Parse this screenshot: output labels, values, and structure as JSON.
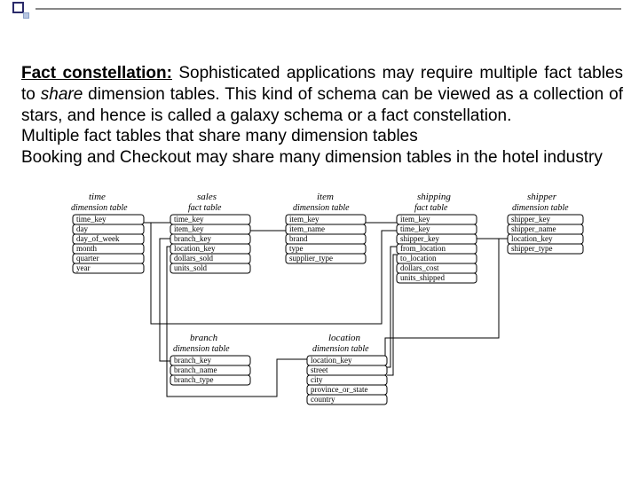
{
  "heading": {
    "title": "Fact constellation:",
    "desc1a": " Sophisticated applications may require multiple fact tables to ",
    "desc1_share": "share",
    "desc1b": " dimension tables. This kind of schema can be viewed as a collection of stars, and hence is called a galaxy schema or a fact constellation.",
    "line2": "Multiple fact tables that share many dimension tables",
    "line3": "Booking and Checkout may share many dimension tables in the hotel industry"
  },
  "tables": {
    "time": {
      "name": "time",
      "sub": "dimension table",
      "cols": [
        "time_key",
        "day",
        "day_of_week",
        "month",
        "quarter",
        "year"
      ]
    },
    "sales": {
      "name": "sales",
      "sub": "fact table",
      "cols": [
        "time_key",
        "item_key",
        "branch_key",
        "location_key",
        "dollars_sold",
        "units_sold"
      ]
    },
    "item": {
      "name": "item",
      "sub": "dimension table",
      "cols": [
        "item_key",
        "item_name",
        "brand",
        "type",
        "supplier_type"
      ]
    },
    "shipping": {
      "name": "shipping",
      "sub": "fact table",
      "cols": [
        "item_key",
        "time_key",
        "shipper_key",
        "from_location",
        "to_location",
        "dollars_cost",
        "units_shipped"
      ]
    },
    "shipper": {
      "name": "shipper",
      "sub": "dimension table",
      "cols": [
        "shipper_key",
        "shipper_name",
        "location_key",
        "shipper_type"
      ]
    },
    "branch": {
      "name": "branch",
      "sub": "dimension table",
      "cols": [
        "branch_key",
        "branch_name",
        "branch_type"
      ]
    },
    "location": {
      "name": "location",
      "sub": "dimension table",
      "cols": [
        "location_key",
        "street",
        "city",
        "province_or_state",
        "country"
      ]
    }
  }
}
